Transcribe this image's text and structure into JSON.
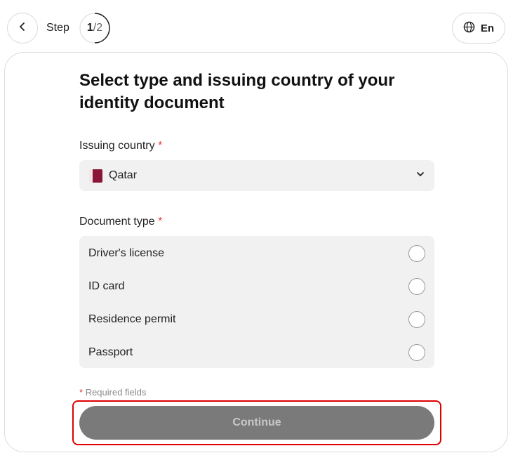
{
  "header": {
    "step_label": "Step",
    "step_current": "1",
    "step_separator": "/",
    "step_total": "2",
    "language": "En"
  },
  "form": {
    "title": "Select type and issuing country of your identity document",
    "country": {
      "label": "Issuing country",
      "required_mark": "*",
      "value": "Qatar",
      "flag_color": "#8a1538"
    },
    "document_type": {
      "label": "Document type",
      "required_mark": "*",
      "options": [
        {
          "label": "Driver's license"
        },
        {
          "label": "ID card"
        },
        {
          "label": "Residence permit"
        },
        {
          "label": "Passport"
        }
      ]
    },
    "required_note_mark": "*",
    "required_note": "Required fields",
    "continue_label": "Continue"
  },
  "colors": {
    "required": "#e53935",
    "button_disabled_bg": "#7a7a7a",
    "highlight_outline": "#e00000"
  }
}
